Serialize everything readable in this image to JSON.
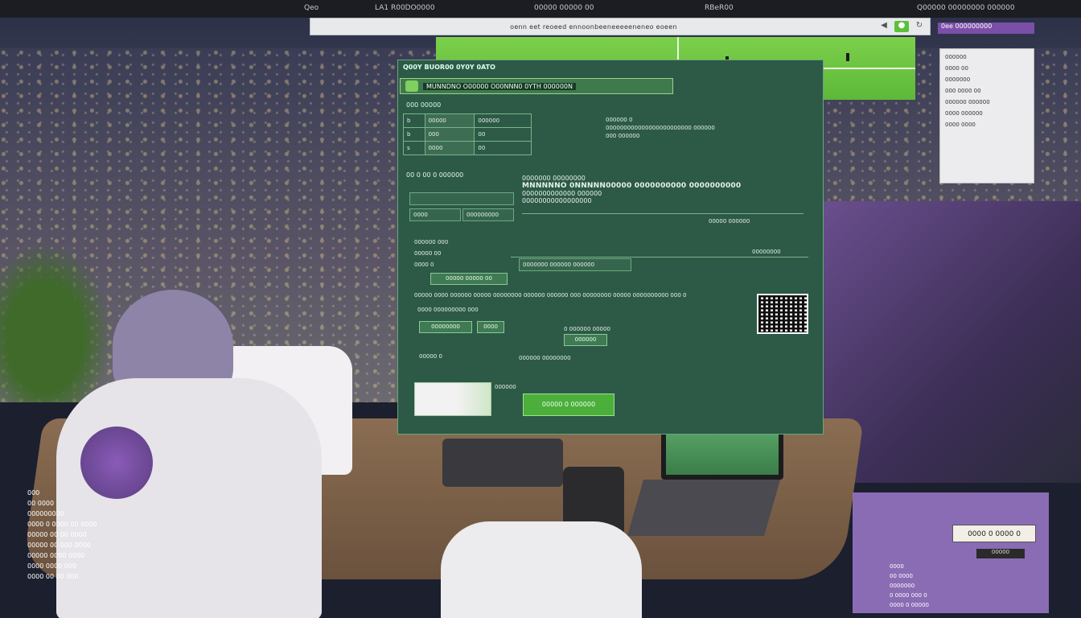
{
  "topbar": {
    "items": [
      "Qeo",
      "LA1 R00DO0000",
      "00000 00000 00",
      "RBeR00",
      "Q00000 00000000 000000"
    ]
  },
  "browser": {
    "url": "oenn eet reoeed ennoonbeeneeeeeneneo eoeen",
    "back_glyph": "◀",
    "go_glyph": "●",
    "reload_glyph": "↻",
    "ext_tab": "0ee 000000000"
  },
  "window": {
    "title": "Q00Y BUOR00 0Y0Y 0ATO",
    "header_text": "MUNNDNO O00000 O00NNN0 0YTH 000000N",
    "tab_label": "000 00000",
    "table": [
      {
        "icon": "b",
        "label": "00000",
        "value": "000000"
      },
      {
        "icon": "b",
        "label": "000",
        "value": "00"
      },
      {
        "icon": "s",
        "label": "0000",
        "value": "00"
      }
    ],
    "info": [
      "000000 0",
      "000000000000000000000000 000000",
      "000 000000"
    ],
    "sub_heading": "00 0 00 0 000000",
    "fields": [
      "",
      "0000",
      "000000000"
    ],
    "notice_line1": "0000000 00000000",
    "notice_line2": "MNNNNNO 0NNNNN00000 0000000000 0000000000",
    "notice_line3": "0000000000000 000000",
    "notice_line4": "00000000000000000",
    "notice_right": "00000 000000",
    "notice_right2": "00000000",
    "group_label": "000000 000",
    "group_lines": [
      "00000 00",
      "0000 0"
    ],
    "small_btn": "00000 00000 00",
    "long_field": "0000000 000000 000000",
    "wide_text": "00000 0000 000000 00000 00000000 000000 000000 000 00000000 00000 0000000000 000 0",
    "left_btn1": "00000000",
    "left_btn2": "0000",
    "row_label": "0000 000000000 000",
    "mid_label": "0 000000 00000",
    "mid_btn": "000000",
    "bottom_label": "00000 0",
    "bottom_right": "000000 00000000",
    "thumb_caption": "000000",
    "primary_button": "00000 0 000000"
  },
  "notes": {
    "lines": [
      "000000",
      "0000 00",
      "0000000",
      "000 0000 00",
      "000000 000000",
      "0000 000000",
      "0000 0000"
    ]
  },
  "left_overlay": {
    "lines": [
      "000",
      "00 0000",
      "000000000",
      "0000 0 0000 00 0000",
      "00000 00 00 0000",
      "00000 00 000 0000",
      "00000 0000 0000",
      "0000 0000 000",
      "0000 00 00 000"
    ]
  },
  "purple_panel": {
    "label": "0000 0 0000 0",
    "sub": "00000",
    "lines": [
      "0000",
      "00 0000",
      "0000000",
      "0 0000 000 0",
      "0000 0 00000"
    ]
  },
  "colors": {
    "window_bg": "#2c5a46",
    "accent_green": "#4caf3c",
    "accent_purple": "#7a4fa8"
  }
}
